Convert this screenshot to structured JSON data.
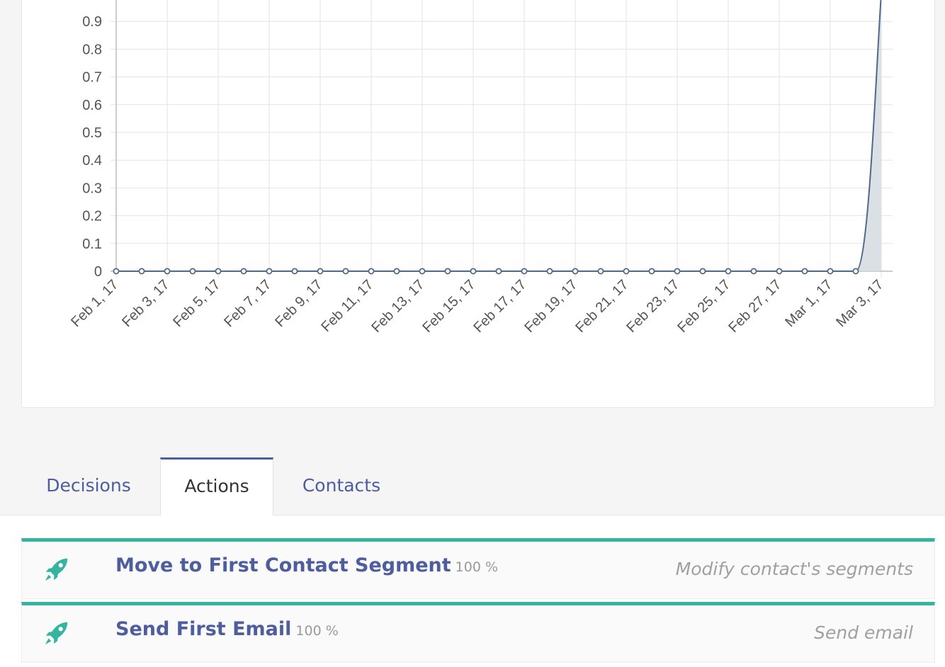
{
  "colors": {
    "accent": "#4e5d9d",
    "teal": "#35b5a0",
    "line": "#4e6a8a",
    "fill": "#d6dde1",
    "grid": "#e3e3e3"
  },
  "chart_data": {
    "type": "line",
    "y_tick_labels": [
      "0",
      "0.1",
      "0.2",
      "0.3",
      "0.4",
      "0.5",
      "0.6",
      "0.7",
      "0.8",
      "0.9"
    ],
    "ylim": [
      0,
      1
    ],
    "x_tick_labels": [
      "Feb 1, 17",
      "Feb 3, 17",
      "Feb 5, 17",
      "Feb 7, 17",
      "Feb 9, 17",
      "Feb 11, 17",
      "Feb 13, 17",
      "Feb 15, 17",
      "Feb 17, 17",
      "Feb 19, 17",
      "Feb 21, 17",
      "Feb 23, 17",
      "Feb 25, 17",
      "Feb 27, 17",
      "Mar 1, 17",
      "Mar 3, 17"
    ],
    "x": [
      "Feb 1, 17",
      "Feb 2, 17",
      "Feb 3, 17",
      "Feb 4, 17",
      "Feb 5, 17",
      "Feb 6, 17",
      "Feb 7, 17",
      "Feb 8, 17",
      "Feb 9, 17",
      "Feb 10, 17",
      "Feb 11, 17",
      "Feb 12, 17",
      "Feb 13, 17",
      "Feb 14, 17",
      "Feb 15, 17",
      "Feb 16, 17",
      "Feb 17, 17",
      "Feb 18, 17",
      "Feb 19, 17",
      "Feb 20, 17",
      "Feb 21, 17",
      "Feb 22, 17",
      "Feb 23, 17",
      "Feb 24, 17",
      "Feb 25, 17",
      "Feb 26, 17",
      "Feb 27, 17",
      "Feb 28, 17",
      "Mar 1, 17",
      "Mar 2, 17",
      "Mar 3, 17"
    ],
    "values": [
      0,
      0,
      0,
      0,
      0,
      0,
      0,
      0,
      0,
      0,
      0,
      0,
      0,
      0,
      0,
      0,
      0,
      0,
      0,
      0,
      0,
      0,
      0,
      0,
      0,
      0,
      0,
      0,
      0,
      0,
      1
    ],
    "grid": true
  },
  "tabs": [
    {
      "label": "Decisions",
      "active": false
    },
    {
      "label": "Actions",
      "active": true
    },
    {
      "label": "Contacts",
      "active": false
    }
  ],
  "actions": [
    {
      "icon": "rocket-icon",
      "title": "Move to First Contact Segment",
      "percent": "100 %",
      "type": "Modify contact's segments"
    },
    {
      "icon": "rocket-icon",
      "title": "Send First Email",
      "percent": "100 %",
      "type": "Send email"
    }
  ]
}
